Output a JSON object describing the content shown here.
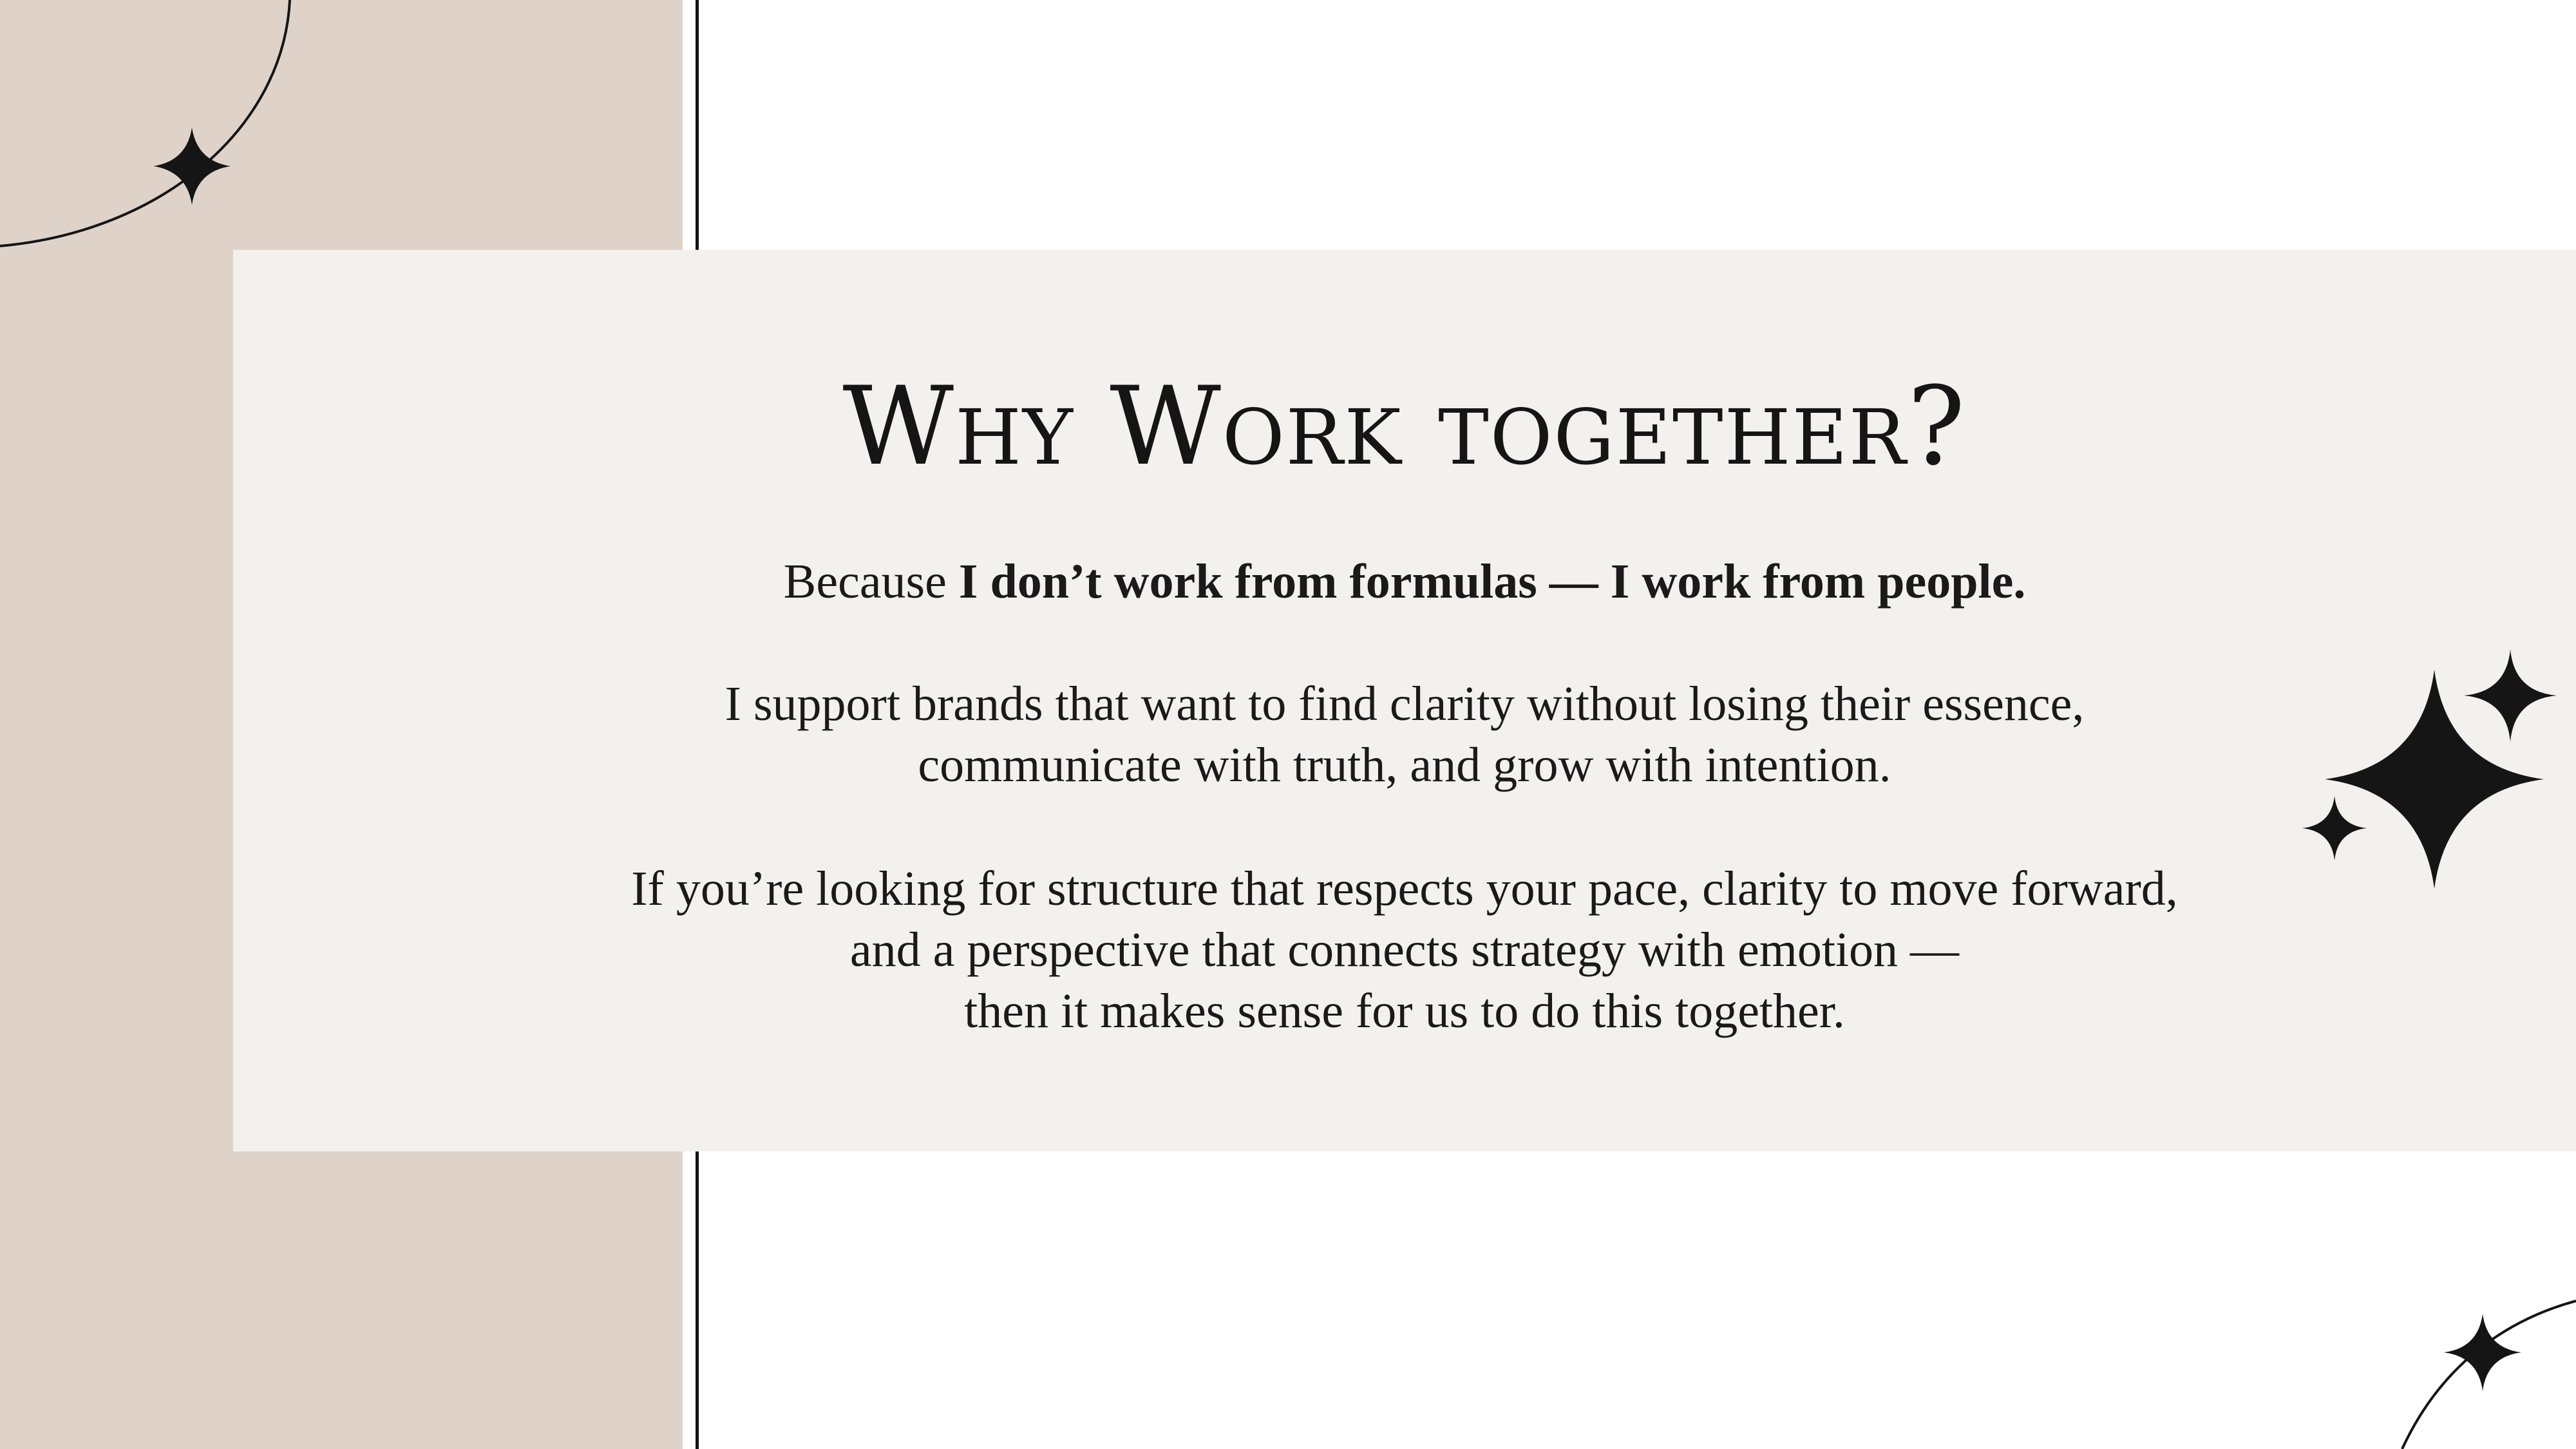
{
  "slide": {
    "heading": "Why Work together?",
    "intro": {
      "lead": "Because ",
      "emphasis": "I don’t work from formulas — I work from people."
    },
    "support_lines": [
      "I support brands that want to find clarity without losing their essence,",
      "communicate with truth, and grow with intention."
    ],
    "closing_lines": [
      "If you’re looking for structure that respects your pace, clarity to move forward,",
      "and a perspective that connects strategy with emotion —",
      "then it makes sense for us to do this together."
    ]
  },
  "colors": {
    "background": "#ffffff",
    "left_panel": "#dfd3c9",
    "card": "#f2f1ed",
    "ink": "#151515"
  },
  "decorations": {
    "top_left": [
      "orbit-arc-icon",
      "sparkle-star-icon"
    ],
    "right_cluster": [
      "sparkle-star-large-icon",
      "sparkle-star-small-icon",
      "sparkle-star-tiny-icon"
    ],
    "bottom_right": [
      "orbit-arc-icon",
      "sparkle-star-icon"
    ]
  }
}
